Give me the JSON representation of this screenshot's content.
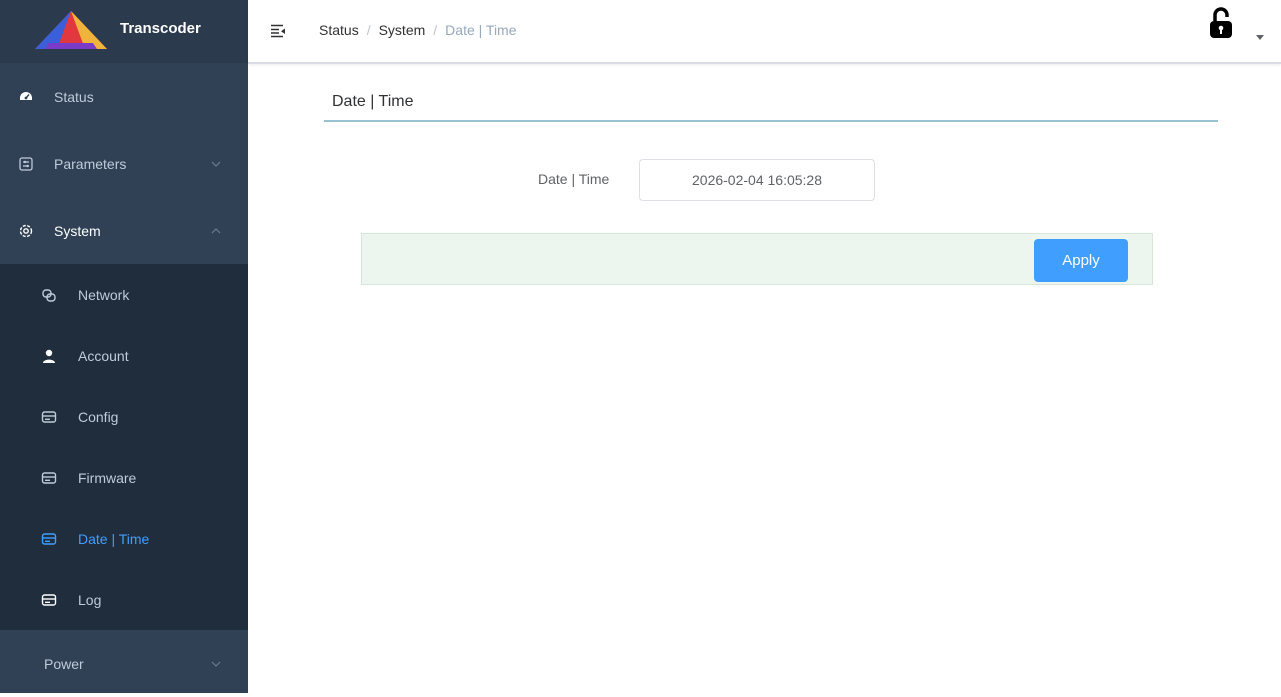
{
  "app": {
    "title": "Transcoder"
  },
  "sidebar": {
    "items": [
      {
        "label": "Status"
      },
      {
        "label": "Parameters"
      },
      {
        "label": "System"
      },
      {
        "label": "Power"
      }
    ],
    "system_children": [
      {
        "label": "Network"
      },
      {
        "label": "Account"
      },
      {
        "label": "Config"
      },
      {
        "label": "Firmware"
      },
      {
        "label": "Date | Time"
      },
      {
        "label": "Log"
      }
    ]
  },
  "header": {
    "breadcrumb": [
      "Status",
      "System",
      "Date | Time"
    ],
    "separator": "/"
  },
  "main": {
    "section_title": "Date | Time",
    "field_label": "Date | Time",
    "field_value": "2026-02-04 16:05:28",
    "apply_label": "Apply"
  },
  "colors": {
    "sidebar_bg": "#304156",
    "submenu_bg": "#1f2d3d",
    "active": "#409eff",
    "action_bar_bg": "#ecf5ee"
  }
}
